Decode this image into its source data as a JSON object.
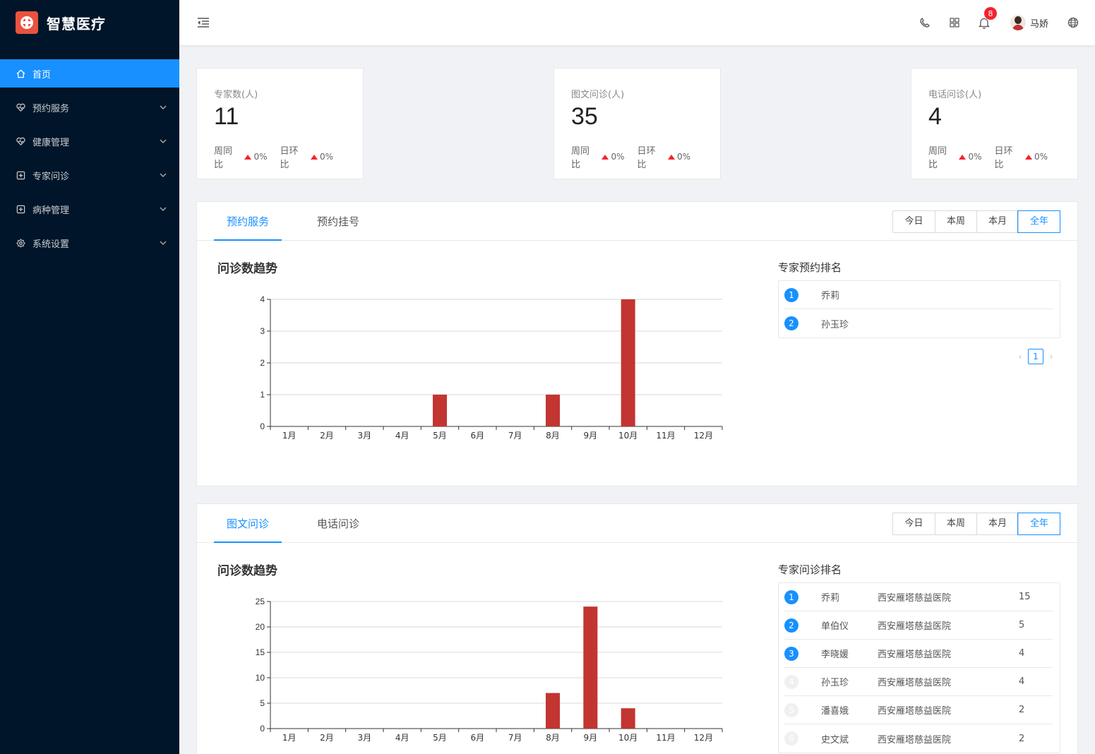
{
  "app": {
    "title": "智慧医疗"
  },
  "sidebar": {
    "items": [
      {
        "label": "首页",
        "icon": "home-icon",
        "active": true
      },
      {
        "label": "预约服务",
        "icon": "heart-icon"
      },
      {
        "label": "健康管理",
        "icon": "heart-icon"
      },
      {
        "label": "专家问诊",
        "icon": "plus-box-icon"
      },
      {
        "label": "病种管理",
        "icon": "plus-box-icon"
      },
      {
        "label": "系统设置",
        "icon": "gear-icon"
      }
    ]
  },
  "header": {
    "notification_count": "8",
    "user_name": "马娇"
  },
  "stats": [
    {
      "title": "专家数(人)",
      "value": "11",
      "week_label": "周同比",
      "week_pct": "0%",
      "day_label": "日环比",
      "day_pct": "0%"
    },
    {
      "title": "图文问诊(人)",
      "value": "35",
      "week_label": "周同比",
      "week_pct": "0%",
      "day_label": "日环比",
      "day_pct": "0%"
    },
    {
      "title": "电话问诊(人)",
      "value": "4",
      "week_label": "周同比",
      "week_pct": "0%",
      "day_label": "日环比",
      "day_pct": "0%"
    }
  ],
  "range_buttons": [
    "今日",
    "本周",
    "本月",
    "全年"
  ],
  "panel1": {
    "tabs": [
      "预约服务",
      "预约挂号"
    ],
    "chart_title": "问诊数趋势",
    "rank_title": "专家预约排名",
    "rank": [
      {
        "num": "1",
        "name": "乔莉"
      },
      {
        "num": "2",
        "name": "孙玉珍"
      }
    ],
    "page": "1"
  },
  "panel2": {
    "tabs": [
      "图文问诊",
      "电话问诊"
    ],
    "chart_title": "问诊数趋势",
    "rank_title": "专家问诊排名",
    "rank": [
      {
        "num": "1",
        "name": "乔莉",
        "hospital": "西安雁塔慈益医院",
        "count": "15"
      },
      {
        "num": "2",
        "name": "单伯仪",
        "hospital": "西安雁塔慈益医院",
        "count": "5"
      },
      {
        "num": "3",
        "name": "李晓媛",
        "hospital": "西安雁塔慈益医院",
        "count": "4"
      },
      {
        "num": "4",
        "name": "孙玉珍",
        "hospital": "西安雁塔慈益医院",
        "count": "4"
      },
      {
        "num": "5",
        "name": "潘喜娥",
        "hospital": "西安雁塔慈益医院",
        "count": "2"
      },
      {
        "num": "6",
        "name": "史文斌",
        "hospital": "西安雁塔慈益医院",
        "count": "2"
      }
    ]
  },
  "colors": {
    "accent": "#1890ff",
    "bar": "#c23531",
    "sidebar": "#001529"
  },
  "chart_data": [
    {
      "type": "bar",
      "categories": [
        "1月",
        "2月",
        "3月",
        "4月",
        "5月",
        "6月",
        "7月",
        "8月",
        "9月",
        "10月",
        "11月",
        "12月"
      ],
      "values": [
        0,
        0,
        0,
        0,
        1,
        0,
        0,
        1,
        0,
        4,
        0,
        0
      ],
      "ylim": [
        0,
        4
      ],
      "yticks": [
        0,
        1,
        2,
        3,
        4
      ],
      "grid": true,
      "xlabel": "",
      "ylabel": ""
    },
    {
      "type": "bar",
      "categories": [
        "1月",
        "2月",
        "3月",
        "4月",
        "5月",
        "6月",
        "7月",
        "8月",
        "9月",
        "10月",
        "11月",
        "12月"
      ],
      "values": [
        0,
        0,
        0,
        0,
        0,
        0,
        0,
        7,
        24,
        4,
        0,
        0
      ],
      "ylim": [
        0,
        25
      ],
      "yticks": [
        0,
        5,
        10,
        15,
        20,
        25
      ],
      "grid": true,
      "xlabel": "",
      "ylabel": ""
    }
  ]
}
